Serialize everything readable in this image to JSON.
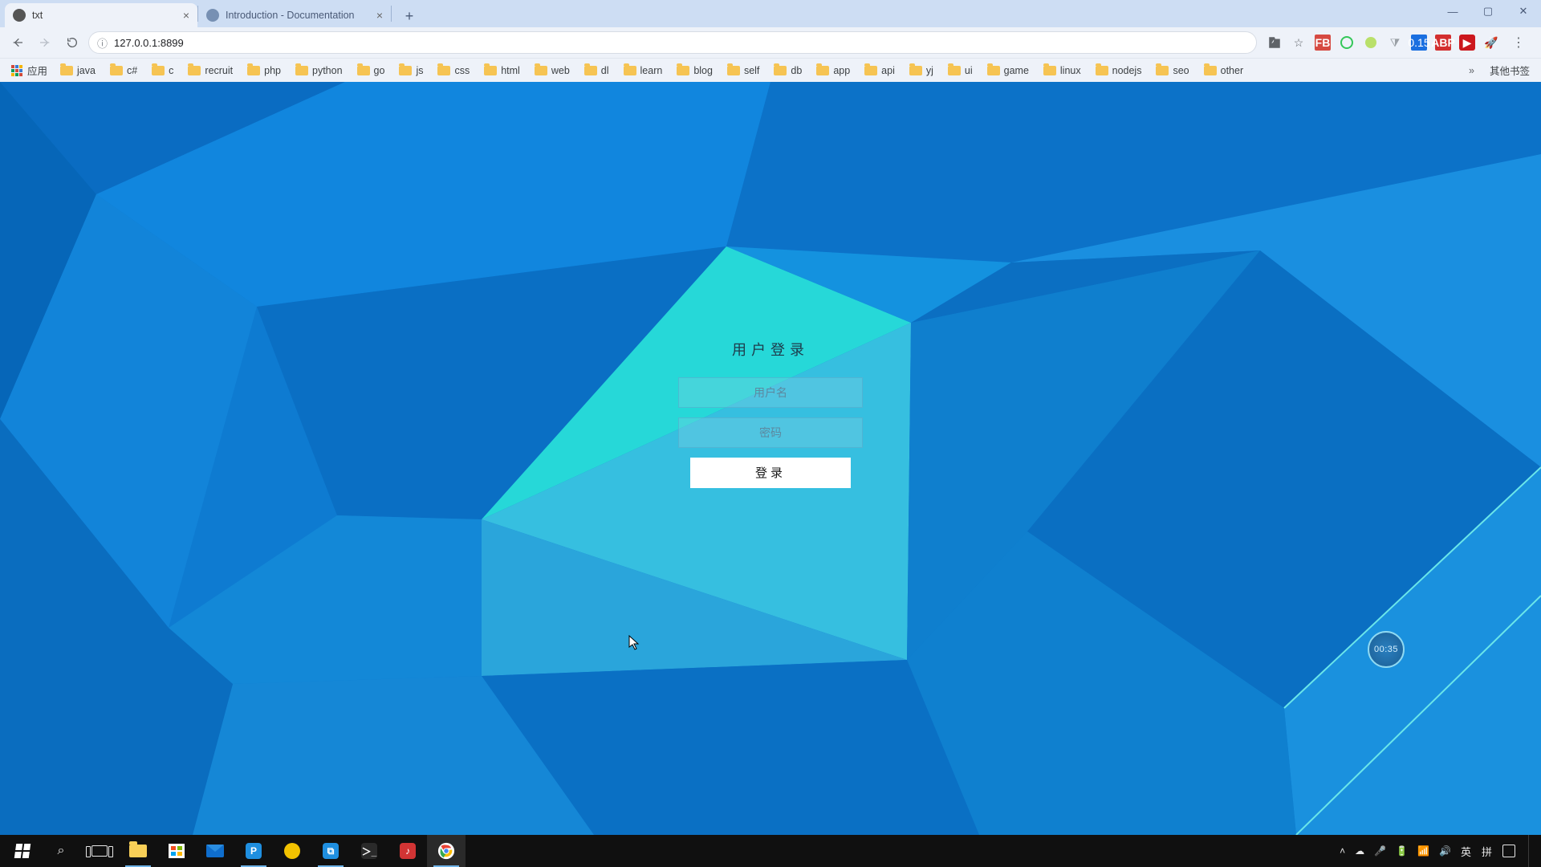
{
  "tabs": {
    "active": {
      "title": "txt"
    },
    "inactive": {
      "title": "Introduction - Documentation"
    }
  },
  "address": {
    "url": "127.0.0.1:8899"
  },
  "toolbar_ext": {
    "calendar_badge": "0.15",
    "abp": "ABP",
    "fb": "FB"
  },
  "bookmarks": {
    "apps": "应用",
    "items": [
      "java",
      "c#",
      "c",
      "recruit",
      "php",
      "python",
      "go",
      "js",
      "css",
      "html",
      "web",
      "dl",
      "learn",
      "blog",
      "self",
      "db",
      "app",
      "api",
      "yj",
      "ui",
      "game",
      "linux",
      "nodejs",
      "seo",
      "other"
    ],
    "other": "其他书签"
  },
  "login": {
    "title": "用户登录",
    "username_placeholder": "用户名",
    "password_placeholder": "密码",
    "submit": "登录"
  },
  "timer": "00:35",
  "tray": {
    "ime1": "英",
    "ime2": "拼"
  }
}
